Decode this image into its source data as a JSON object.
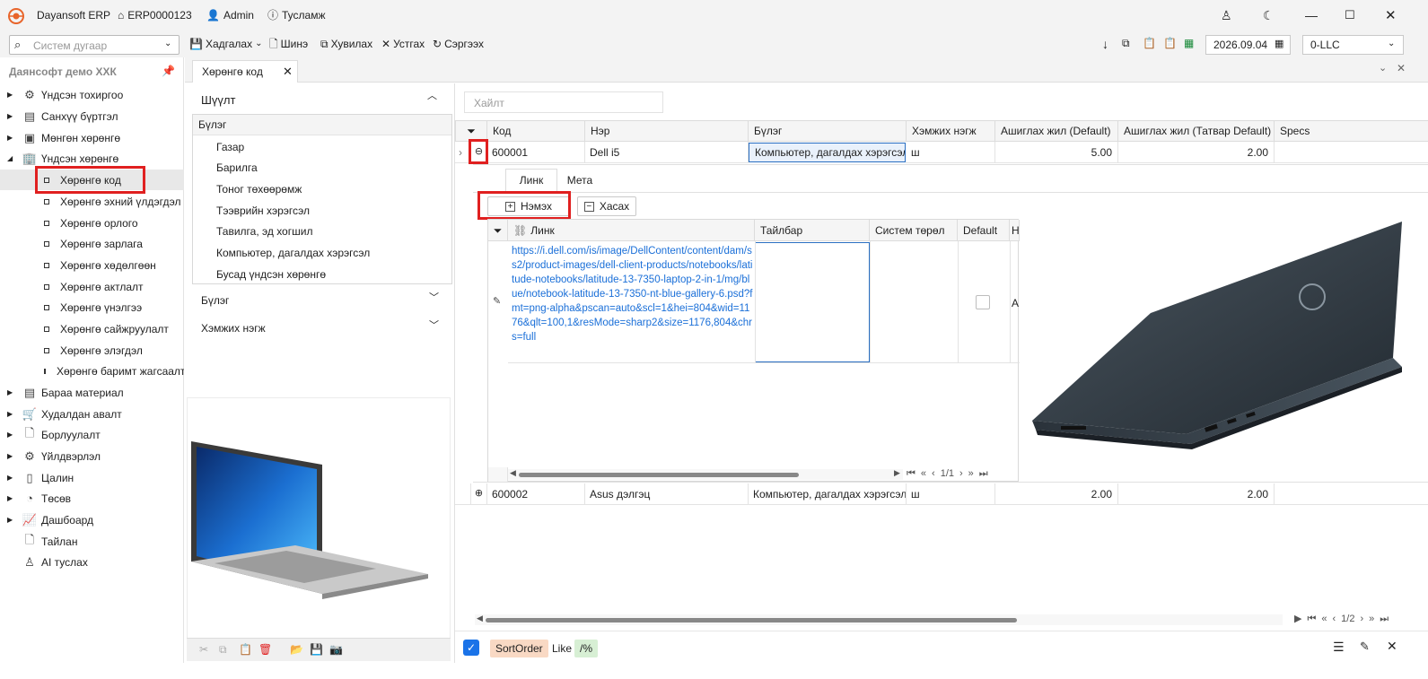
{
  "colors": {
    "accent_red": "#e02020",
    "link_blue": "#1a6fd8",
    "selected_cell_border": "#2a6fc2",
    "checkbox_blue": "#1a73e8",
    "sort_chip": "#f9d9c4",
    "like_chip": "#d7efd4",
    "logo_orange": "#e8642a"
  },
  "titlebar": {
    "app_name": "Dayansoft ERP",
    "erp_id": "ERP0000123",
    "user": "Admin",
    "help": "Тусламж"
  },
  "toolbar": {
    "search_placeholder": "Систем дугаар",
    "save": "Хадгалах",
    "new": "Шинэ",
    "copy": "Хувилах",
    "delete": "Устгах",
    "refresh": "Сэргээх",
    "date": "2026.09.04",
    "company": "0-LLC"
  },
  "sidebar": {
    "header": "Даянсофт демо ХХК",
    "items": [
      {
        "label": "Үндсэн тохиргоо",
        "icon": "gear-icon"
      },
      {
        "label": "Санхүү бүртгэл",
        "icon": "ledger-icon"
      },
      {
        "label": "Мөнгөн хөрөнгө",
        "icon": "cash-icon"
      },
      {
        "label": "Үндсэн хөрөнгө",
        "icon": "building-icon"
      }
    ],
    "sub_items": [
      "Хөрөнгө код",
      "Хөрөнгө эхний үлдэгдэл",
      "Хөрөнгө орлого",
      "Хөрөнгө зарлага",
      "Хөрөнгө хөдөлгөөн",
      "Хөрөнгө актлалт",
      "Хөрөнгө үнэлгээ",
      "Хөрөнгө сайжруулалт",
      "Хөрөнгө элэгдэл",
      "Хөрөнгө баримт жагсаалт"
    ],
    "items_after": [
      {
        "label": "Бараа материал",
        "icon": "box-icon"
      },
      {
        "label": "Худалдан авалт",
        "icon": "cart-icon"
      },
      {
        "label": "Борлуулалт",
        "icon": "sales-icon"
      },
      {
        "label": "Үйлдвэрлэл",
        "icon": "factory-icon"
      },
      {
        "label": "Цалин",
        "icon": "salary-icon"
      },
      {
        "label": "Төсөв",
        "icon": "budget-icon"
      },
      {
        "label": "Дашбоард",
        "icon": "dashboard-icon"
      },
      {
        "label": "Тайлан",
        "icon": "report-icon"
      },
      {
        "label": "AI туслах",
        "icon": "robot-icon"
      }
    ]
  },
  "tab": {
    "label": "Хөрөнгө код"
  },
  "filter": {
    "title": "Шүүлт",
    "group_header": "Бүлэг",
    "groups": [
      "Газар",
      "Барилга",
      "Тоног төхөөрөмж",
      "Тээврийн хэрэгсэл",
      "Тавилга, эд хогшил",
      "Компьютер, дагалдах хэрэгсэл",
      "Бусад үндсэн хөрөнгө"
    ],
    "section_group": "Бүлэг",
    "section_unit": "Хэмжих нэгж"
  },
  "grid": {
    "search_placeholder": "Хайлт",
    "columns": [
      "Код",
      "Нэр",
      "Бүлэг",
      "Хэмжих нэгж",
      "Ашиглах жил (Default)",
      "Ашиглах жил (Татвар Default)",
      "Specs"
    ],
    "rows": [
      {
        "code": "600001",
        "name": "Dell i5",
        "group": "Компьютер, дагалдах хэрэгсэл",
        "unit": "ш",
        "years": "5.00",
        "tax_years": "2.00"
      },
      {
        "code": "600002",
        "name": "Asus дэлгэц",
        "group": "Компьютер, дагалдах хэрэгсэл",
        "unit": "ш",
        "years": "2.00",
        "tax_years": "2.00"
      }
    ],
    "pager": "1/2"
  },
  "detail": {
    "tabs": [
      "Линк",
      "Мета"
    ],
    "add": "Нэмэх",
    "remove": "Хасах",
    "columns": [
      "Линк",
      "Тайлбар",
      "Систем төрөл",
      "Default",
      "Н"
    ],
    "link_value": "https://i.dell.com/is/image/DellContent/content/dam/ss2/product-images/dell-client-products/notebooks/latitude-notebooks/latitude-13-7350-laptop-2-in-1/mg/blue/notebook-latitude-13-7350-nt-blue-gallery-6.psd?fmt=png-alpha&pscan=auto&scl=1&hei=804&wid=1176&qlt=100,1&resMode=sharp2&size=1176,804&chrs=full",
    "cut_char": "А",
    "pager": "1/1"
  },
  "statusbar": {
    "sort_field": "SortOrder",
    "op": "Like",
    "value": "/%"
  }
}
